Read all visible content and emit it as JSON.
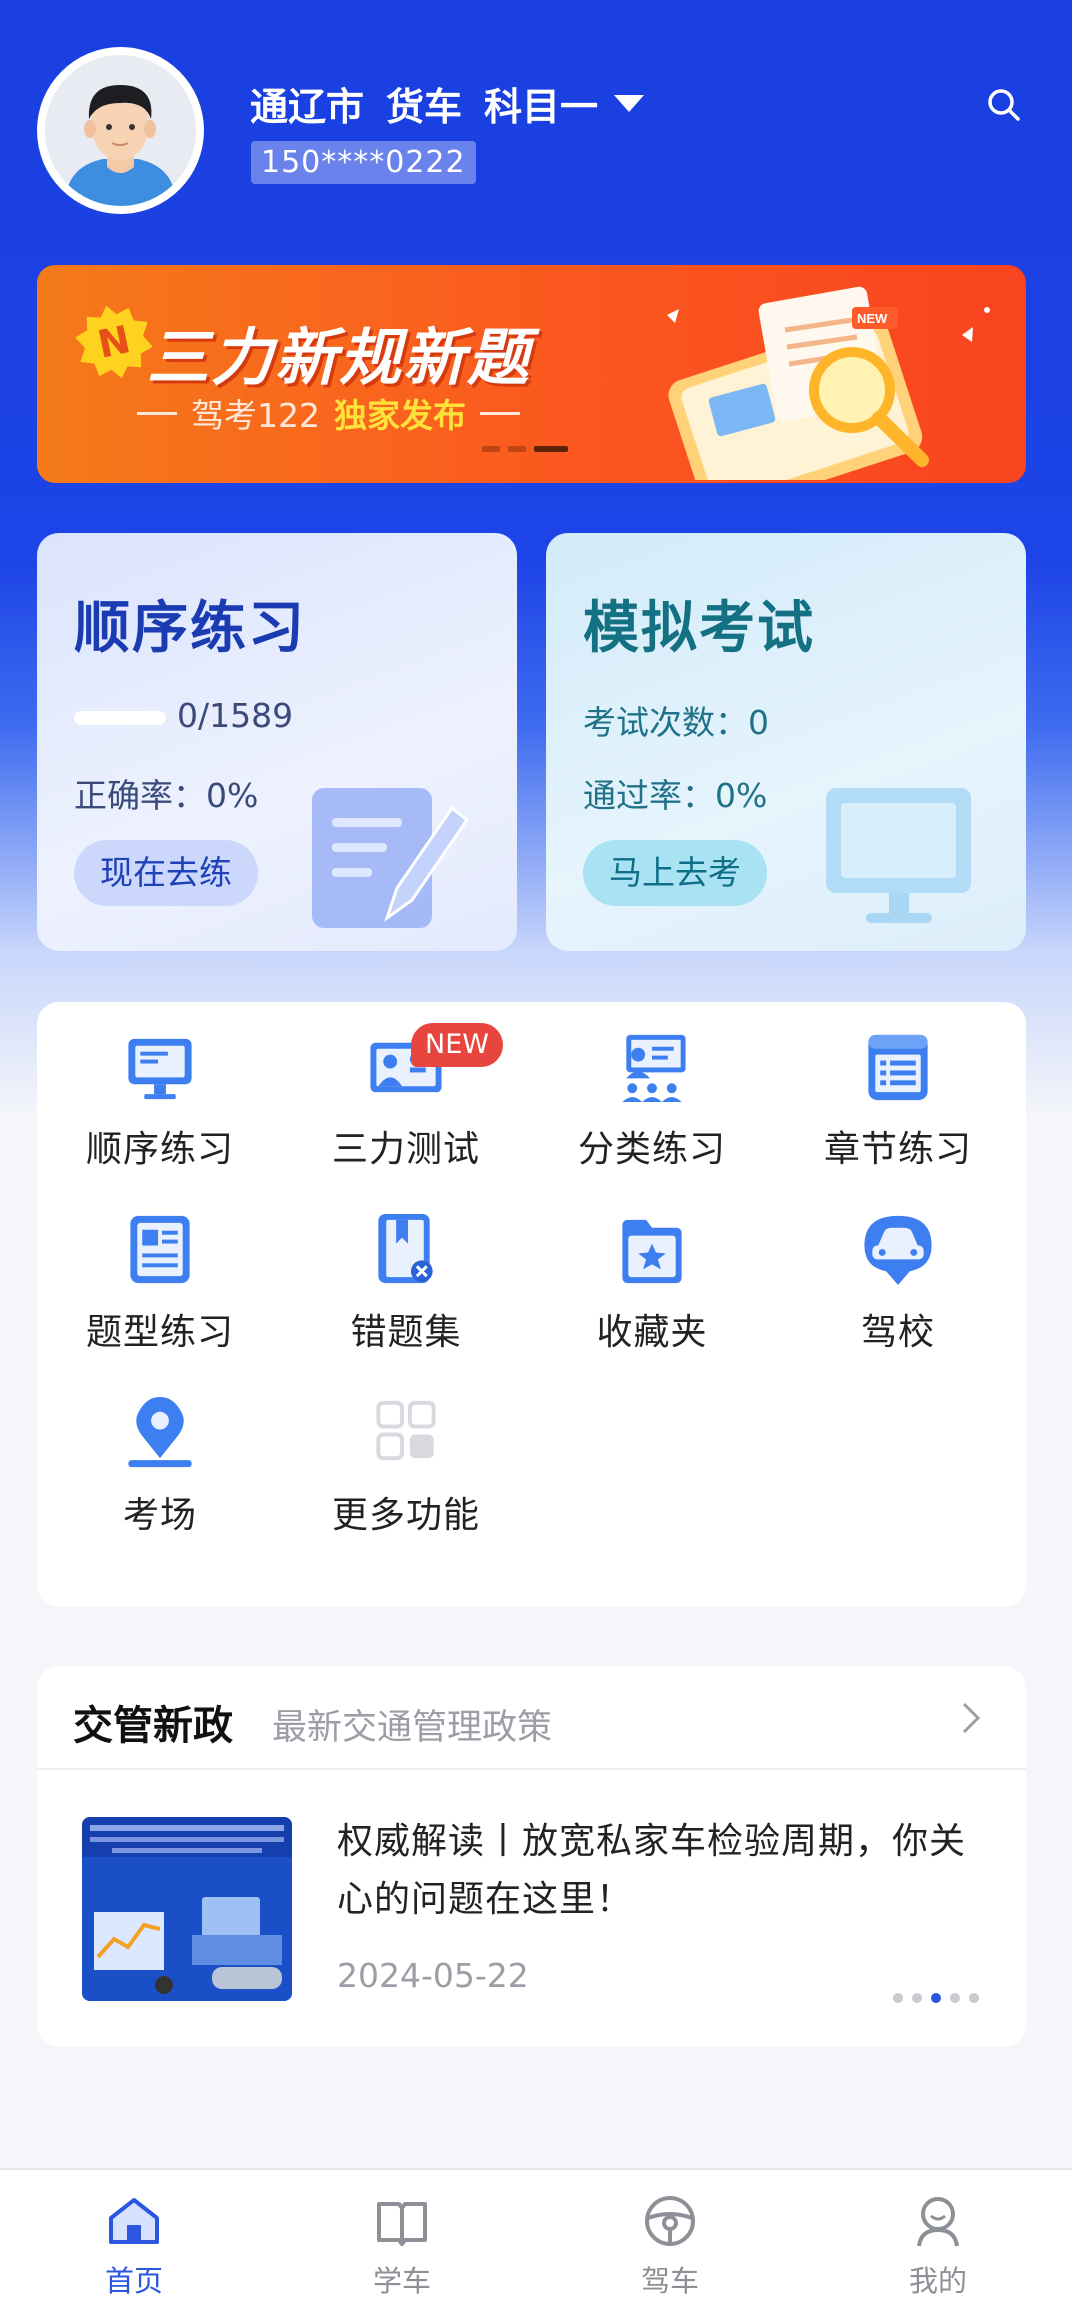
{
  "header": {
    "city": "通辽市",
    "vehicle": "货车",
    "subject": "科目一",
    "phone": "150****0222"
  },
  "banner": {
    "title": "三力新规新题",
    "sub_prefix": "驾考122",
    "sub_highlight": "独家发布",
    "new_tag": "NEW",
    "n_badge": "N"
  },
  "practice": {
    "title": "顺序练习",
    "progress_text": "0/1589",
    "progress_done": 0,
    "progress_total": 1589,
    "accuracy": "正确率：0%",
    "button": "现在去练"
  },
  "exam": {
    "title": "模拟考试",
    "count": "考试次数：0",
    "pass_rate": "通过率：0%",
    "button": "马上去考"
  },
  "grid": {
    "items": [
      {
        "label": "顺序练习",
        "icon": "monitor-icon"
      },
      {
        "label": "三力测试",
        "icon": "presenter-icon"
      },
      {
        "label": "分类练习",
        "icon": "classroom-icon"
      },
      {
        "label": "章节练习",
        "icon": "list-book-icon"
      },
      {
        "label": "题型练习",
        "icon": "document-icon"
      },
      {
        "label": "错题集",
        "icon": "wrong-book-icon"
      },
      {
        "label": "收藏夹",
        "icon": "star-folder-icon"
      },
      {
        "label": "驾校",
        "icon": "car-pin-icon"
      },
      {
        "label": "考场",
        "icon": "location-pin-icon"
      },
      {
        "label": "更多功能",
        "icon": "grid-more-icon"
      }
    ],
    "new_badge": "NEW"
  },
  "news": {
    "title": "交管新政",
    "subtitle": "最新交通管理政策",
    "headline": "权威解读丨放宽私家车检验周期，你关心的问题在这里！",
    "date": "2024-05-22"
  },
  "tabs": [
    {
      "label": "首页",
      "icon": "home-icon",
      "active": true
    },
    {
      "label": "学车",
      "icon": "book-icon",
      "active": false
    },
    {
      "label": "驾车",
      "icon": "steering-wheel-icon",
      "active": false
    },
    {
      "label": "我的",
      "icon": "profile-icon",
      "active": false
    }
  ],
  "colors": {
    "brand_blue": "#1a3fe0",
    "accent_blue": "#2a56e0",
    "banner_orange": "#f8431f",
    "badge_red": "#e8453e"
  }
}
